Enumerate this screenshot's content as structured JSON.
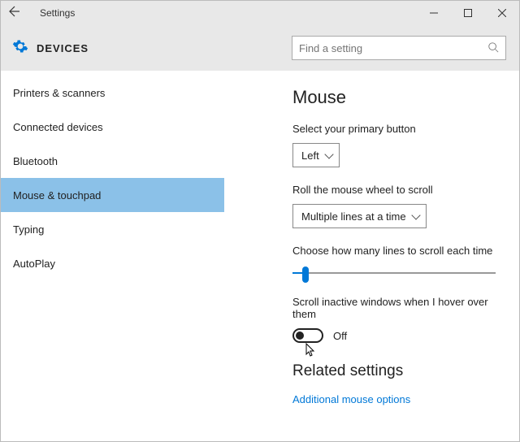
{
  "titlebar": {
    "title": "Settings"
  },
  "header": {
    "title": "DEVICES",
    "search_placeholder": "Find a setting"
  },
  "sidebar": {
    "items": [
      {
        "label": "Printers & scanners"
      },
      {
        "label": "Connected devices"
      },
      {
        "label": "Bluetooth"
      },
      {
        "label": "Mouse & touchpad"
      },
      {
        "label": "Typing"
      },
      {
        "label": "AutoPlay"
      }
    ]
  },
  "content": {
    "heading": "Mouse",
    "primary_button_label": "Select your primary button",
    "primary_button_value": "Left",
    "wheel_label": "Roll the mouse wheel to scroll",
    "wheel_value": "Multiple lines at a time",
    "lines_label": "Choose how many lines to scroll each time",
    "inactive_label": "Scroll inactive windows when I hover over them",
    "toggle_state": "Off",
    "related_heading": "Related settings",
    "related_link": "Additional mouse options"
  }
}
